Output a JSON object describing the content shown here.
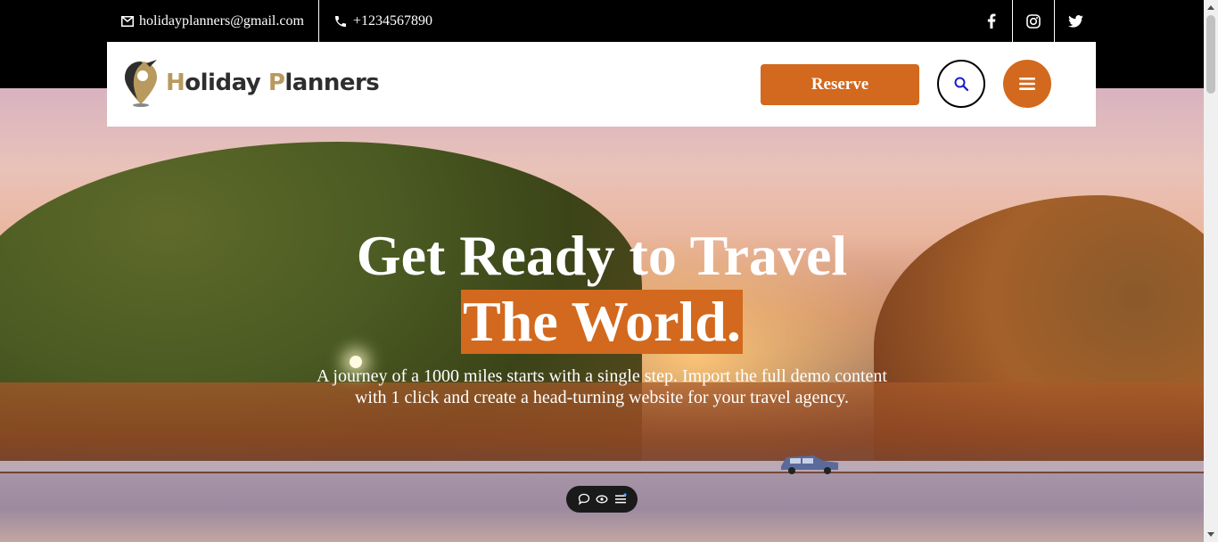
{
  "topbar": {
    "email": "holidayplanners@gmail.com",
    "phone": "+1234567890",
    "socials": [
      {
        "icon": "facebook-icon"
      },
      {
        "icon": "instagram-icon"
      },
      {
        "icon": "twitter-icon"
      }
    ]
  },
  "header": {
    "logo_first_letter": "H",
    "logo_word1_rest": "oliday ",
    "logo_second_letter": "P",
    "logo_word2_rest": "lanners",
    "reserve_label": "Reserve",
    "search_icon": "search-icon",
    "menu_icon": "hamburger-menu-icon"
  },
  "hero": {
    "title_line1": "Get Ready to Travel",
    "title_line2": "The World.",
    "subtitle": "A journey of a 1000 miles starts with a single step. Import the full demo content with 1 click and create a head-turning website for your travel agency."
  },
  "floating_toolbar": {
    "icons": [
      "chat-bubble-icon",
      "eye-icon",
      "list-icon"
    ]
  },
  "colors": {
    "accent": "#d2691e",
    "logo_gold": "#b89a5e",
    "topbar_bg": "#000000"
  }
}
